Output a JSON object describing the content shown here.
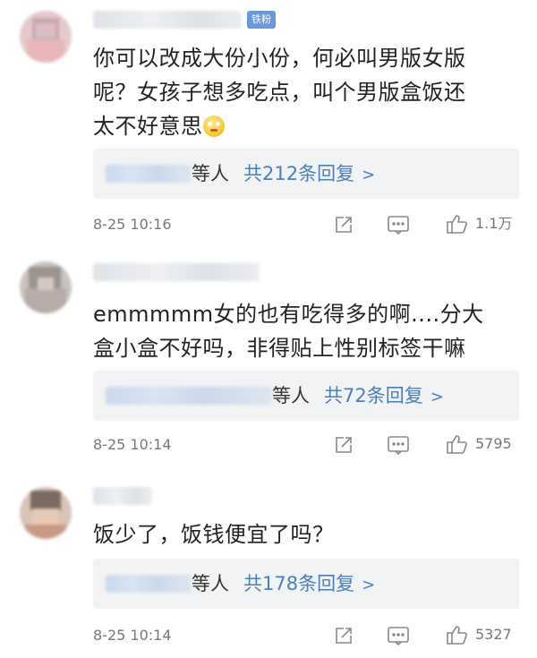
{
  "comments": [
    {
      "badge": "铁粉",
      "text_lines": [
        "你可以改成大份小份，何必叫男版女版",
        "呢？女孩子想多吃点，叫个男版盒饭还",
        "太不好意思"
      ],
      "emoji": "flushed-face-emoji",
      "reply_suffix": "等人",
      "reply_link": "共212条回复",
      "reply_chevron": ">",
      "time": "8-25 10:16",
      "likes": "1.1万"
    },
    {
      "text_lines": [
        "emmmmm女的也有吃得多的啊....分大",
        "盒小盒不好吗，非得贴上性别标签干嘛"
      ],
      "reply_suffix": "等人",
      "reply_link": "共72条回复",
      "reply_chevron": ">",
      "time": "8-25 10:14",
      "likes": "5795"
    },
    {
      "text_lines": [
        "饭少了，饭钱便宜了吗？"
      ],
      "reply_suffix": "等人",
      "reply_link": "共178条回复",
      "reply_chevron": ">",
      "time": "8-25 10:14",
      "likes": "5327"
    }
  ],
  "icons": {
    "share": "share-icon",
    "comment": "comment-icon",
    "like": "like-icon"
  },
  "colors": {
    "badge": "#6a98d8",
    "link": "#4a7ebd",
    "reply_bg": "#f2f3f5",
    "meta": "#777777"
  }
}
